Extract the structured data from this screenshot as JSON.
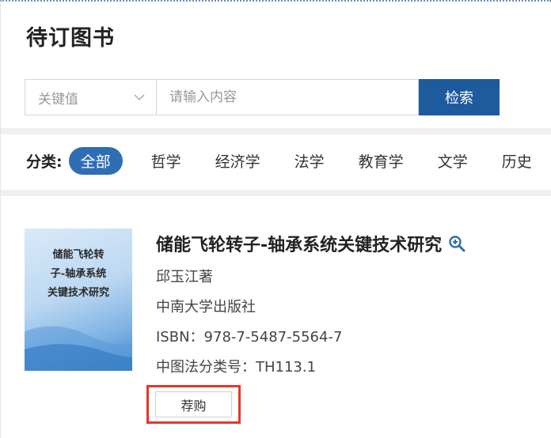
{
  "page": {
    "title": "待订图书"
  },
  "search": {
    "field_select": "关键值",
    "placeholder": "请输入内容",
    "button_label": "检索"
  },
  "categories": {
    "label": "分类:",
    "items": [
      "全部",
      "哲学",
      "经济学",
      "法学",
      "教育学",
      "文学",
      "历史"
    ]
  },
  "book": {
    "cover_lines": [
      "储能飞轮转",
      "子-轴承系统",
      "关键技术研究"
    ],
    "title": "储能飞轮转子-轴承系统关键技术研究",
    "author": "邱玉江著",
    "publisher": "中南大学出版社",
    "isbn": "ISBN：978-7-5487-5564-7",
    "clc": "中图法分类号：TH113.1",
    "buy_label": "荐购"
  },
  "colors": {
    "primary": "#1d5a9e",
    "active_tab": "#2f6db5",
    "highlight_border": "#e8352b"
  }
}
